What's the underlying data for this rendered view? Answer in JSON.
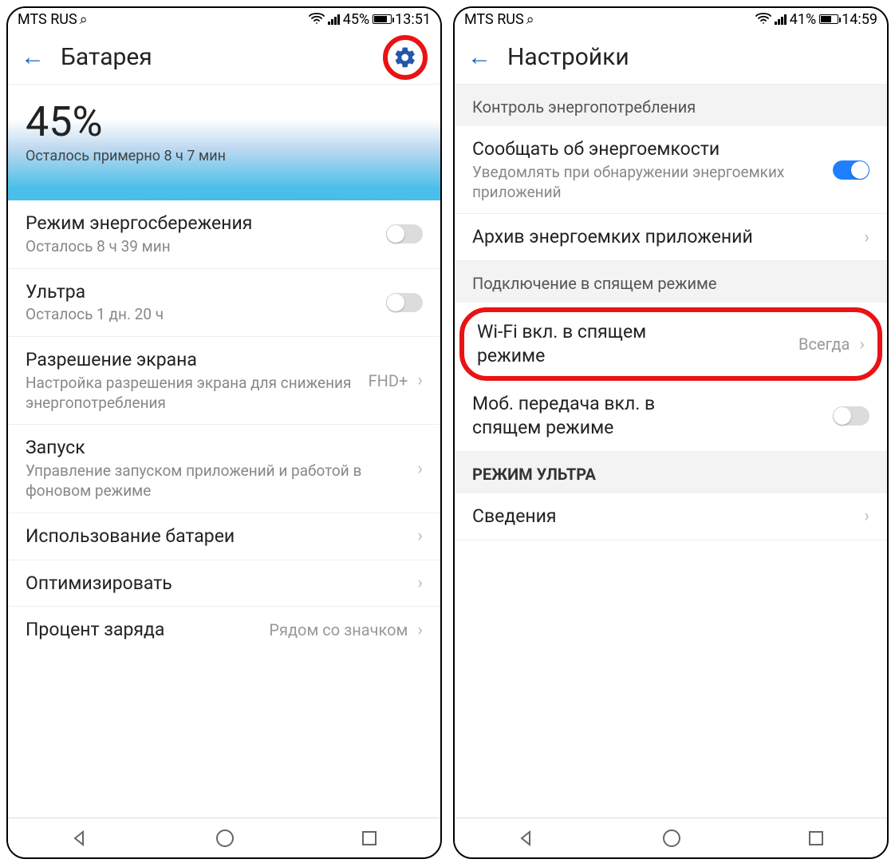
{
  "left": {
    "status": {
      "carrier": "MTS RUS",
      "batt_pct": "45%",
      "time": "13:51",
      "batt_fill_pct": 70
    },
    "title": "Батарея",
    "hero": {
      "pct": "45%",
      "note": "Осталось примерно 8 ч 7 мин"
    },
    "rows": {
      "power_save": {
        "title": "Режим энергосбережения",
        "sub": "Осталось 8 ч 39 мин"
      },
      "ultra": {
        "title": "Ультра",
        "sub": "Осталось 1 дн. 20 ч"
      },
      "resolution": {
        "title": "Разрешение экрана",
        "sub": "Настройка разрешения экрана для снижения энергопотребления",
        "value": "FHD+"
      },
      "launch": {
        "title": "Запуск",
        "sub": "Управление запуском приложений и работой в фоновом режиме"
      },
      "usage": {
        "title": "Использование батареи"
      },
      "optimize": {
        "title": "Оптимизировать"
      },
      "percent": {
        "title": "Процент заряда",
        "value": "Рядом со значком"
      }
    }
  },
  "right": {
    "status": {
      "carrier": "MTS RUS",
      "batt_pct": "41%",
      "time": "14:59",
      "batt_fill_pct": 60
    },
    "title": "Настройки",
    "sections": {
      "power_ctrl": "Контроль энергопотребления",
      "sleep_conn": "Подключение в спящем режиме",
      "ultra_mode": "РЕЖИМ УЛЬТРА"
    },
    "rows": {
      "notify_heavy": {
        "title": "Сообщать об энергоемкости",
        "sub": "Уведомлять при обнаружении энергоемких приложений"
      },
      "archive": {
        "title": "Архив энергоемких приложений"
      },
      "wifi_sleep": {
        "title": "Wi-Fi вкл. в спящем режиме",
        "value": "Всегда"
      },
      "mobdata_sleep": {
        "title": "Моб. передача вкл. в спящем режиме"
      },
      "info": {
        "title": "Сведения"
      }
    }
  }
}
